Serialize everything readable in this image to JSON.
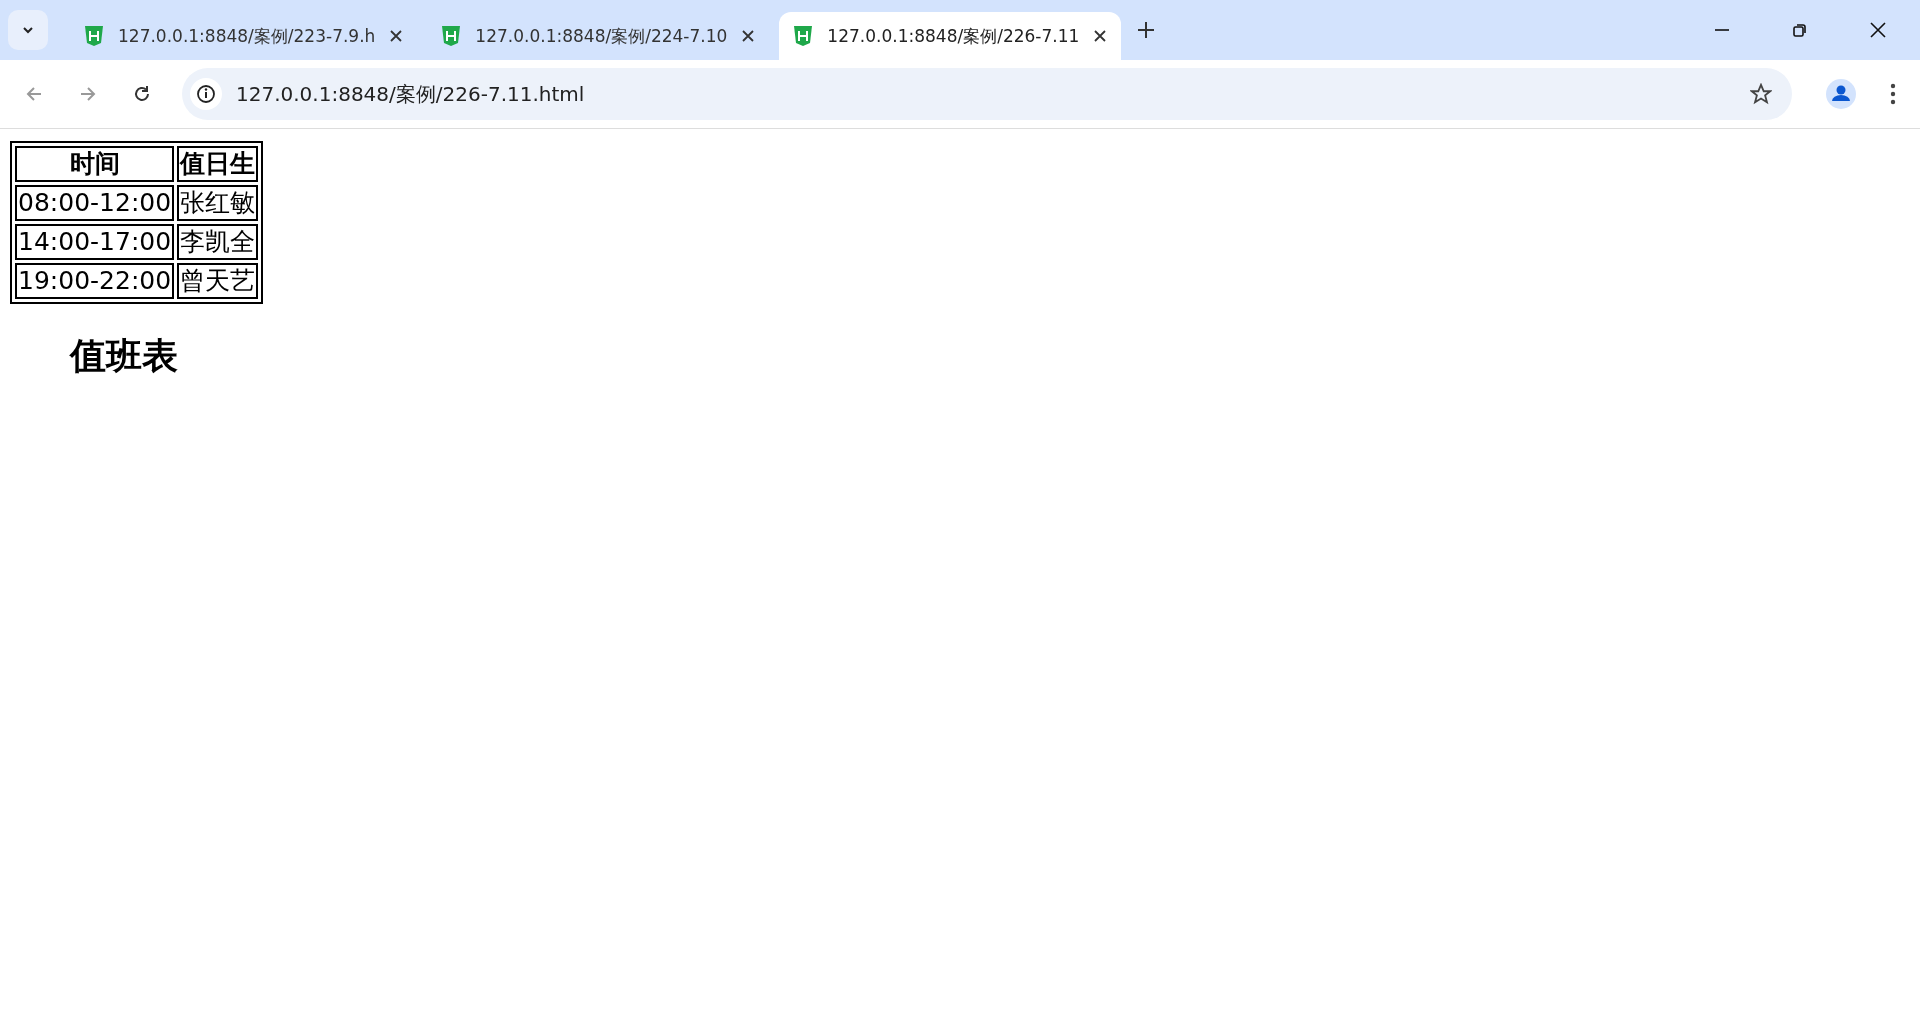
{
  "tabs": [
    {
      "title": "127.0.0.1:8848/案例/223-7.9.h",
      "selected": false
    },
    {
      "title": "127.0.0.1:8848/案例/224-7.10",
      "selected": false
    },
    {
      "title": "127.0.0.1:8848/案例/226-7.11",
      "selected": true
    }
  ],
  "address_bar": {
    "url": "127.0.0.1:8848/案例/226-7.11.html"
  },
  "table": {
    "columns": [
      "时间",
      "值日生"
    ],
    "rows": [
      [
        "08:00-12:00",
        "张红敏"
      ],
      [
        "14:00-17:00",
        "李凯全"
      ],
      [
        "19:00-22:00",
        "曾天艺"
      ]
    ]
  },
  "heading": "值班表"
}
